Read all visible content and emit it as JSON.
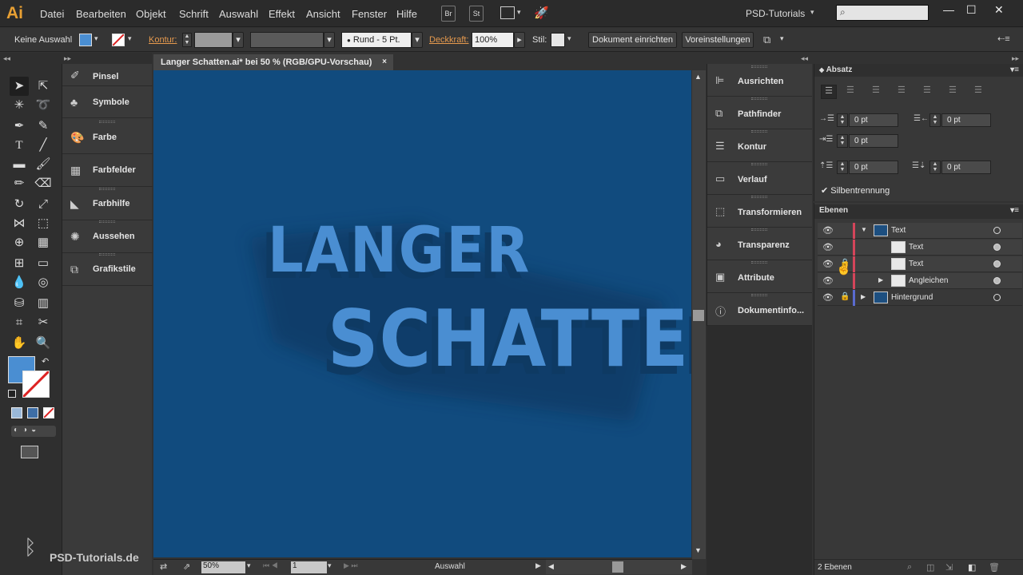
{
  "app": {
    "logo": "Ai"
  },
  "menu": [
    "Datei",
    "Bearbeiten",
    "Objekt",
    "Schrift",
    "Auswahl",
    "Effekt",
    "Ansicht",
    "Fenster",
    "Hilfe"
  ],
  "bridge_buttons": [
    "Br",
    "St"
  ],
  "workspace": "PSD-Tutorials",
  "control_bar": {
    "selection": "Keine Auswahl",
    "kontur_label": "Kontur:",
    "stroke_profile": "Rund - 5 Pt.",
    "deckkraft_label": "Deckkraft:",
    "deckkraft_value": "100%",
    "stil_label": "Stil:",
    "dokument_button": "Dokument einrichten",
    "voreinstellungen_button": "Voreinstellungen"
  },
  "document": {
    "tab_title": "Langer Schatten.ai* bei 50 % (RGB/GPU-Vorschau)",
    "canvas_line1": "LANGER",
    "canvas_line2": "SCHATTEN",
    "canvas_bg": "#114b7e",
    "text_color": "#4a8ed2"
  },
  "left_panels": [
    {
      "label": "Pinsel",
      "icon": "brush-icon"
    },
    {
      "label": "Symbole",
      "icon": "symbols-icon"
    },
    {
      "label": "Farbe",
      "icon": "palette-icon"
    },
    {
      "label": "Farbfelder",
      "icon": "swatches-icon"
    },
    {
      "label": "Farbhilfe",
      "icon": "color-guide-icon"
    },
    {
      "label": "Aussehen",
      "icon": "appearance-icon"
    },
    {
      "label": "Grafikstile",
      "icon": "graphic-styles-icon"
    }
  ],
  "mid_panels": [
    {
      "label": "Ausrichten",
      "icon": "align-icon"
    },
    {
      "label": "Pathfinder",
      "icon": "pathfinder-icon"
    },
    {
      "label": "Kontur",
      "icon": "stroke-icon"
    },
    {
      "label": "Verlauf",
      "icon": "gradient-icon"
    },
    {
      "label": "Transformieren",
      "icon": "transform-icon"
    },
    {
      "label": "Transparenz",
      "icon": "transparency-icon"
    },
    {
      "label": "Attribute",
      "icon": "attributes-icon"
    },
    {
      "label": "Dokumentinfo...",
      "icon": "document-info-icon"
    }
  ],
  "absatz": {
    "title": "Absatz",
    "indent_left": "0 pt",
    "indent_right": "0 pt",
    "indent_first": "0 pt",
    "space_before": "0 pt",
    "space_after": "0 pt",
    "hyphenation": "Silbentrennung"
  },
  "ebenen": {
    "title": "Ebenen",
    "layers": [
      {
        "name": "Text"
      },
      {
        "name": "Text"
      },
      {
        "name": "Text"
      },
      {
        "name": "Angleichen"
      },
      {
        "name": "Hintergrund"
      }
    ],
    "count": "2 Ebenen"
  },
  "status": {
    "zoom": "50%",
    "artboard": "1",
    "tool": "Auswahl"
  },
  "watermark": "PSD-Tutorials.de"
}
